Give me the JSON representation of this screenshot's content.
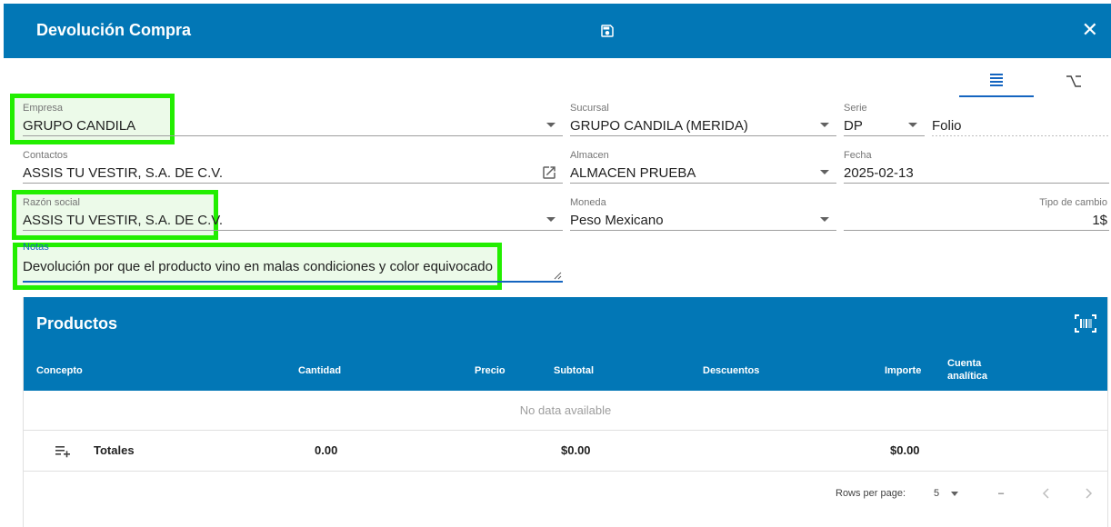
{
  "dialog": {
    "title": "Devolución Compra",
    "close_glyph": "✕"
  },
  "form": {
    "empresa": {
      "label": "Empresa",
      "value": "GRUPO CANDILA"
    },
    "sucursal": {
      "label": "Sucursal",
      "value": "GRUPO CANDILA (MERIDA)"
    },
    "serie": {
      "label": "Serie",
      "value": "DP"
    },
    "folio": {
      "placeholder": "Folio"
    },
    "contactos": {
      "label": "Contactos",
      "value": "ASSIS TU VESTIR, S.A. DE C.V."
    },
    "almacen": {
      "label": "Almacen",
      "value": "ALMACEN PRUEBA"
    },
    "fecha": {
      "label": "Fecha",
      "value": "2025-02-13"
    },
    "razon_social": {
      "label": "Razón social",
      "value": "ASSIS TU VESTIR, S.A. DE C.V."
    },
    "moneda": {
      "label": "Moneda",
      "value": "Peso Mexicano"
    },
    "tipo_cambio": {
      "label": "Tipo de cambio",
      "value": "1$"
    },
    "notas": {
      "label": "Notas",
      "value": "Devolución por que el producto vino en malas condiciones y color equivocado"
    }
  },
  "products": {
    "title": "Productos",
    "columns": [
      "Concepto",
      "Cantidad",
      "Precio",
      "Subtotal",
      "Descuentos",
      "Importe",
      "Cuenta analítica"
    ],
    "no_data": "No data available",
    "totals": {
      "label": "Totales",
      "cantidad": "0.00",
      "subtotal": "$0.00",
      "importe": "$0.00"
    },
    "pager": {
      "rows_label": "Rows per page:",
      "rows_value": "5",
      "range": "–"
    }
  },
  "colors": {
    "primary": "#0277b6",
    "highlight": "#22ee00"
  }
}
